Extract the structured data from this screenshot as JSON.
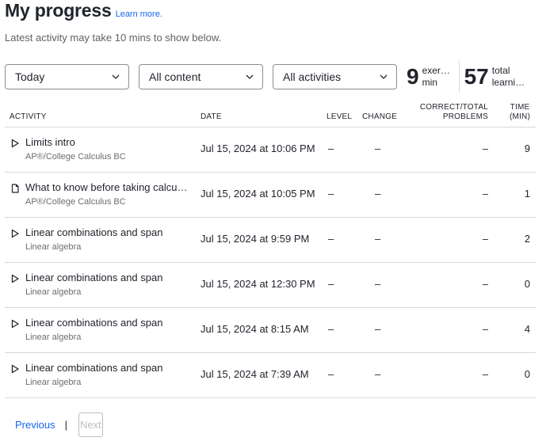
{
  "header": {
    "title": "My progress",
    "learn_more": "Learn more.",
    "subtitle": "Latest activity may take 10 mins to show below."
  },
  "filters": {
    "time": "Today",
    "content": "All content",
    "activities": "All activities"
  },
  "stats": {
    "exercise": {
      "value": "9",
      "label_line1": "exercise",
      "label_line2": "min"
    },
    "total": {
      "value": "57",
      "label_line1": "total",
      "label_line2": "learning..."
    }
  },
  "table": {
    "headers": {
      "activity": "ACTIVITY",
      "date": "DATE",
      "level": "LEVEL",
      "change": "CHANGE",
      "correct_line1": "CORRECT/TOTAL",
      "correct_line2": "PROBLEMS",
      "time_line1": "TIME",
      "time_line2": "(MIN)"
    },
    "rows": [
      {
        "icon": "play-icon",
        "title": "Limits intro",
        "course": "AP®︎/College Calculus BC",
        "date": "Jul 15, 2024 at 10:06 PM",
        "level": "–",
        "change": "–",
        "correct": "–",
        "time": "9"
      },
      {
        "icon": "article-icon",
        "title": "What to know before taking calcul...",
        "course": "AP®︎/College Calculus BC",
        "date": "Jul 15, 2024 at 10:05 PM",
        "level": "–",
        "change": "–",
        "correct": "–",
        "time": "1"
      },
      {
        "icon": "play-icon",
        "title": "Linear combinations and span",
        "course": "Linear algebra",
        "date": "Jul 15, 2024 at 9:59 PM",
        "level": "–",
        "change": "–",
        "correct": "–",
        "time": "2"
      },
      {
        "icon": "play-icon",
        "title": "Linear combinations and span",
        "course": "Linear algebra",
        "date": "Jul 15, 2024 at 12:30 PM",
        "level": "–",
        "change": "–",
        "correct": "–",
        "time": "0"
      },
      {
        "icon": "play-icon",
        "title": "Linear combinations and span",
        "course": "Linear algebra",
        "date": "Jul 15, 2024 at 8:15 AM",
        "level": "–",
        "change": "–",
        "correct": "–",
        "time": "4"
      },
      {
        "icon": "play-icon",
        "title": "Linear combinations and span",
        "course": "Linear algebra",
        "date": "Jul 15, 2024 at 7:39 AM",
        "level": "–",
        "change": "–",
        "correct": "–",
        "time": "0"
      }
    ]
  },
  "pagination": {
    "previous": "Previous",
    "separator": "|",
    "next": "Next"
  },
  "colors": {
    "link": "#1865f2",
    "text": "#21242c",
    "muted": "#6b6d72",
    "border": "#d6d8da",
    "disabled": "#bbbdc0"
  }
}
